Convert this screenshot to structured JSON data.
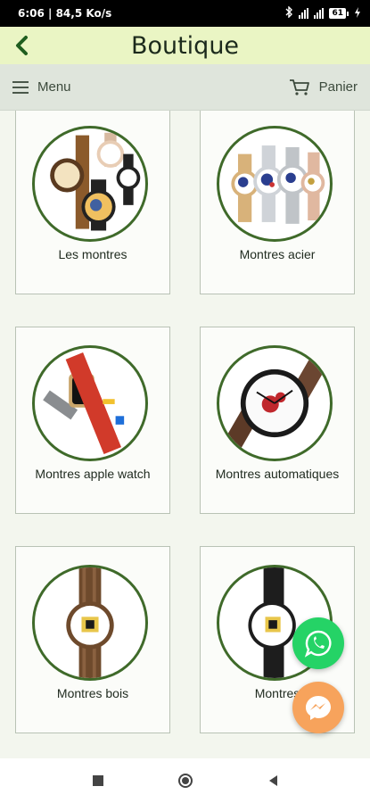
{
  "status_bar": {
    "time_speed": "6:06 | 84,5 Ko/s",
    "battery": "61"
  },
  "header": {
    "title": "Boutique"
  },
  "toolbar": {
    "menu_label": "Menu",
    "cart_label": "Panier"
  },
  "categories": [
    {
      "label": "Les montres"
    },
    {
      "label": "Montres acier"
    },
    {
      "label": "Montres apple watch"
    },
    {
      "label": "Montres automatiques"
    },
    {
      "label": "Montres bois"
    },
    {
      "label": "Montres"
    }
  ],
  "colors": {
    "app_bar": "#eaf5c4",
    "accent": "#1f5e1f",
    "whatsapp": "#25d366",
    "messenger": "#f7a35c"
  }
}
